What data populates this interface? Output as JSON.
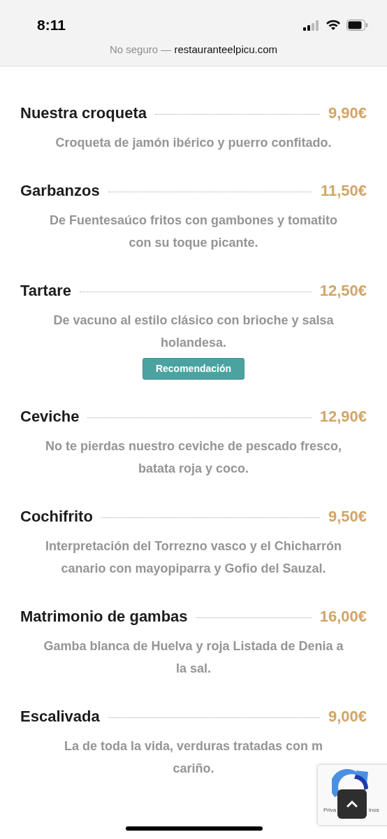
{
  "status_bar": {
    "time": "8:11"
  },
  "address_bar": {
    "security": "No seguro —",
    "domain": "restauranteelpicu.com"
  },
  "menu_items": [
    {
      "name": "Nuestra croqueta",
      "price": "9,90€",
      "description_lines": [
        "Croqueta de jamón ibérico y puerro confitado."
      ]
    },
    {
      "name": "Garbanzos",
      "price": "11,50€",
      "description_lines": [
        "De Fuentesaúco fritos con gambones y tomatito",
        "con su toque picante."
      ]
    },
    {
      "name": "Tartare",
      "price": "12,50€",
      "description_lines": [
        "De vacuno al estilo clásico con brioche y salsa",
        "holandesa."
      ],
      "tag": "Recomendación"
    },
    {
      "name": "Ceviche",
      "price": "12,90€",
      "description_lines": [
        "No te pierdas nuestro ceviche de pescado fresco,",
        "batata roja y coco."
      ]
    },
    {
      "name": "Cochifrito",
      "price": "9,50€",
      "description_lines": [
        "Interpretación del Torrezno vasco y el Chicharrón",
        "canario con mayopiparra y Gofio del Sauzal."
      ]
    },
    {
      "name": "Matrimonio de gambas",
      "price": "16,00€",
      "description_lines": [
        "Gamba blanca de Huelva y roja Listada de Denia a",
        "la sal."
      ]
    },
    {
      "name": "Escalivada",
      "price": "9,00€",
      "description_lines": [
        "La de toda la vida, verduras tratadas con m",
        "cariño."
      ]
    }
  ],
  "recaptcha": {
    "left_text": "Priva",
    "right_text": "inos"
  }
}
